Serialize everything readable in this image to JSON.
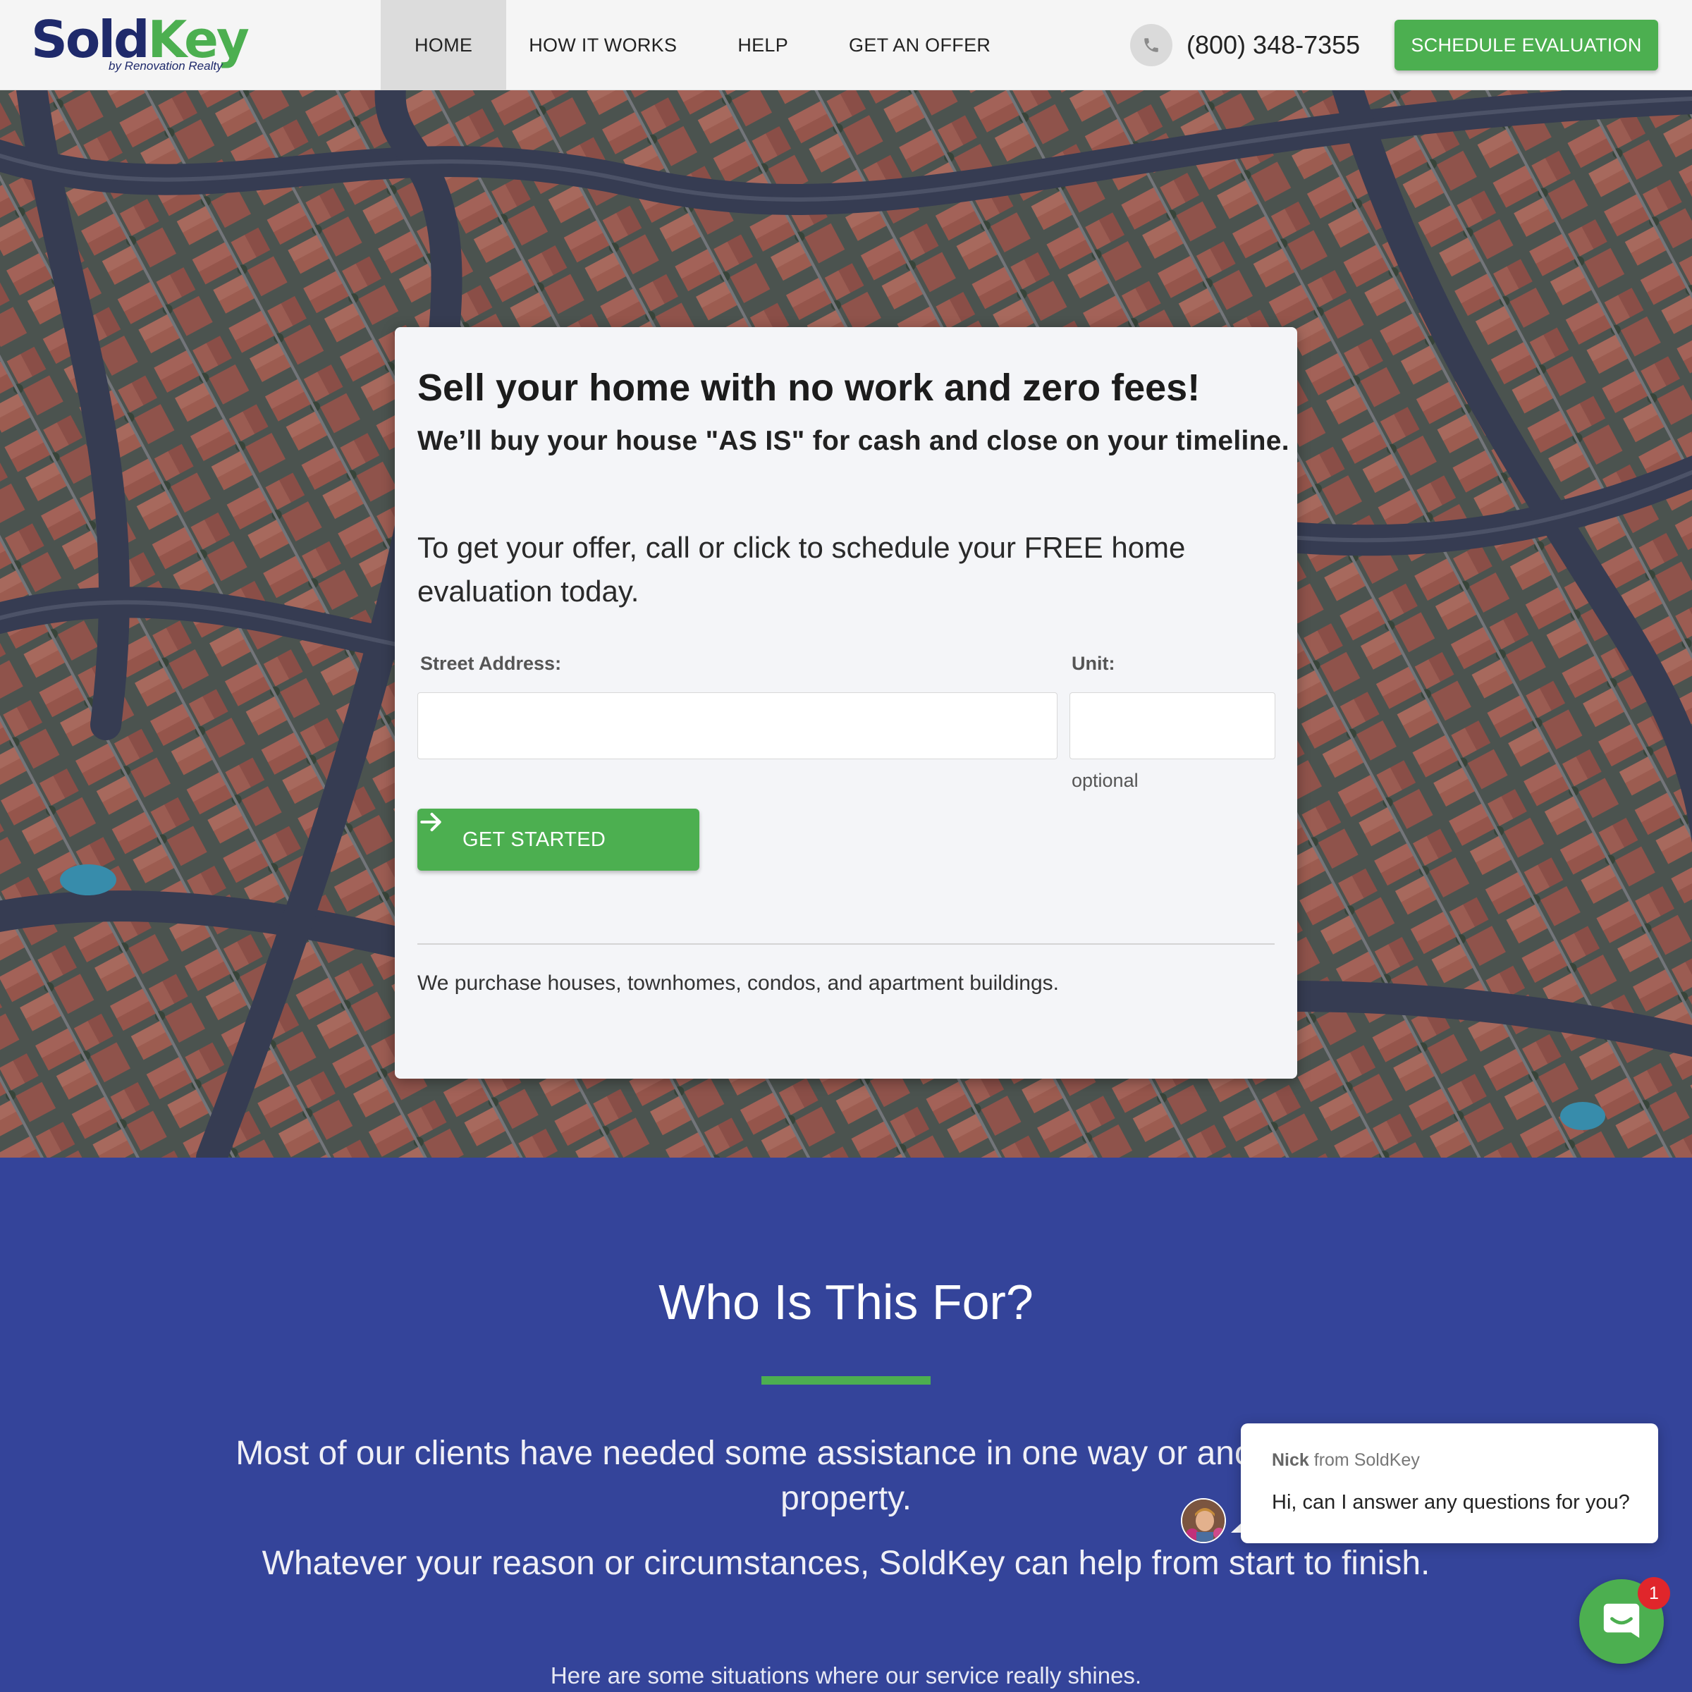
{
  "header": {
    "logo": {
      "word1": "Sold",
      "word2": "Key",
      "tagline": "by Renovation Realty"
    },
    "nav": [
      {
        "label": "HOME",
        "active": true
      },
      {
        "label": "HOW IT WORKS",
        "active": false
      },
      {
        "label": "HELP",
        "active": false
      },
      {
        "label": "GET AN OFFER",
        "active": false
      }
    ],
    "phone_icon": "phone-icon",
    "phone": "(800) 348-7355",
    "cta_label": "SCHEDULE EVALUATION"
  },
  "hero": {
    "background": "aerial-neighborhood-photo",
    "card": {
      "headline": "Sell your home with no work and zero fees!",
      "subheadline": "We’ll buy your house \"AS IS\" for cash and close on your timeline.",
      "lead": "To get your offer, call or click to schedule your FREE home evaluation today.",
      "form": {
        "street_label": "Street Address:",
        "street_value": "",
        "unit_label": "Unit:",
        "unit_value": "",
        "unit_hint": "optional",
        "submit_label": "GET STARTED",
        "submit_icon": "arrow-right-icon"
      },
      "footnote": "We purchase houses, townhomes, condos, and apartment buildings."
    }
  },
  "who": {
    "title": "Who Is This For?",
    "paragraph1": "Most of our clients have needed some assistance in one way or another with their property.",
    "paragraph2": "Whatever your reason or circumstances, SoldKey can help from start to finish.",
    "paragraph3": "Here are some situations where our service really shines."
  },
  "chat": {
    "from_name": "Nick",
    "from_rest": " from SoldKey",
    "message": "Hi, can I answer any questions for you?",
    "badge_count": "1",
    "launcher_icon": "chat-icon"
  },
  "colors": {
    "brand_navy": "#1f2a6b",
    "brand_green": "#4caf50",
    "section_blue": "#34449a",
    "badge_red": "#e0262b"
  }
}
